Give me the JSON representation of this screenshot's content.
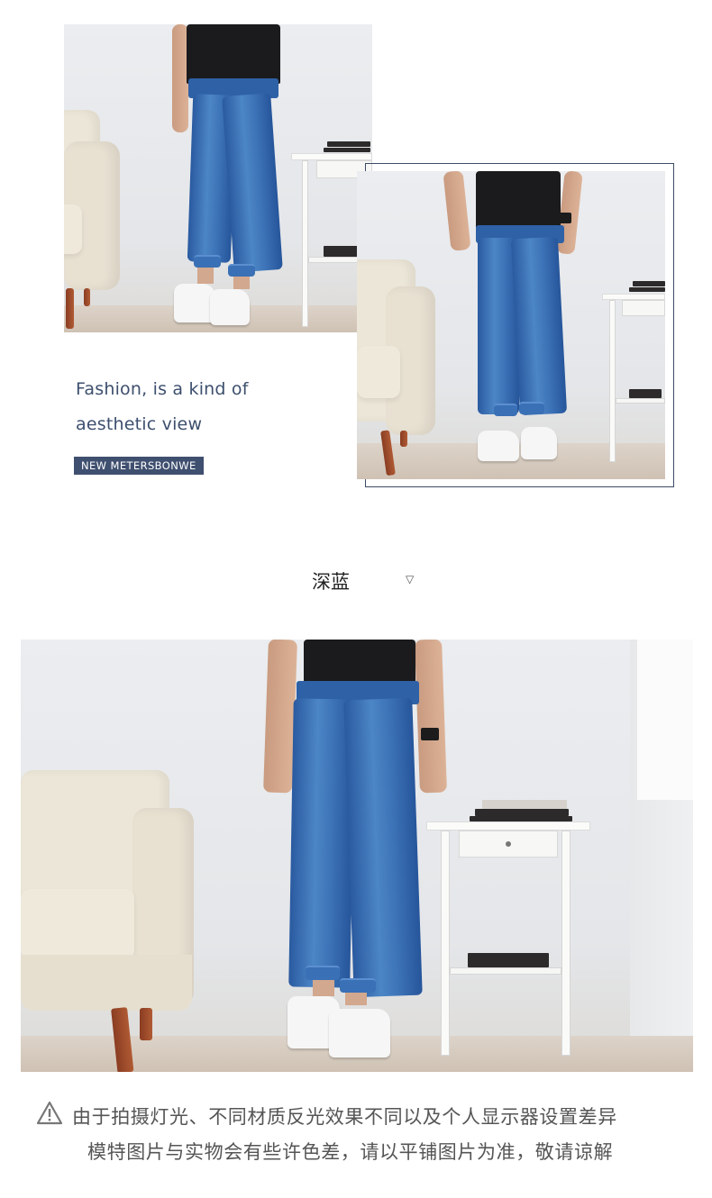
{
  "hero": {
    "tagline_line1": "Fashion, is a kind of",
    "tagline_line2": "aesthetic view",
    "brand": "NEW METERSBONWE"
  },
  "color_section": {
    "color_name": "深蓝",
    "expand_glyph": "▽"
  },
  "notice": {
    "icon": "warning-icon",
    "line1": "由于拍摄灯光、不同材质反光效果不同以及个人显示器设置差异",
    "line2": "模特图片与实物会有些许色差，请以平铺图片为准，敬请谅解"
  },
  "colors": {
    "accent": "#3f4f6f",
    "denim": "#2f61a6"
  }
}
